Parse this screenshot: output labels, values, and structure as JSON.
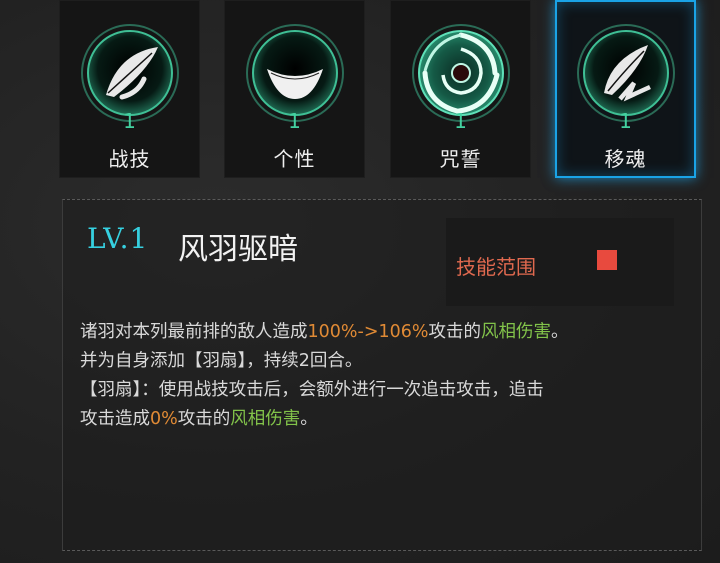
{
  "tabs": [
    {
      "id": "battle",
      "label": "战技",
      "level": "1",
      "icon": "feather-blade-icon",
      "selected": false
    },
    {
      "id": "trait",
      "label": "个性",
      "level": "1",
      "icon": "crescent-smile-icon",
      "selected": false
    },
    {
      "id": "curse",
      "label": "咒誓",
      "level": "1",
      "icon": "vortex-icon",
      "selected": false
    },
    {
      "id": "soul",
      "label": "移魂",
      "level": "1",
      "icon": "feather-lightning-icon",
      "selected": true
    }
  ],
  "skill": {
    "level_label": "LV.1",
    "name": "风羽驱暗",
    "range_label": "技能范围",
    "description": {
      "line1": {
        "a": "诸羽对本列最前排的敌人造成",
        "b": "100%->106%",
        "c": "攻击的",
        "d": "风相伤害",
        "e": "。"
      },
      "line2": "并为自身添加【羽扇】，持续2回合。",
      "line3": "【羽扇】：使用战技攻击后，会额外进行一次追击攻击，追击",
      "line4": {
        "a": "攻击造成",
        "b": "0%",
        "c": "攻击的",
        "d": "风相伤害",
        "e": "。"
      }
    }
  },
  "colors": {
    "level_text": "#36d0e0",
    "tab_level": "#43d1a0",
    "selected_border": "#1aa3e6",
    "highlight_value": "#e08a35",
    "highlight_element": "#82c34a",
    "range_label": "#e0694f",
    "range_marker": "#e84a3e"
  }
}
